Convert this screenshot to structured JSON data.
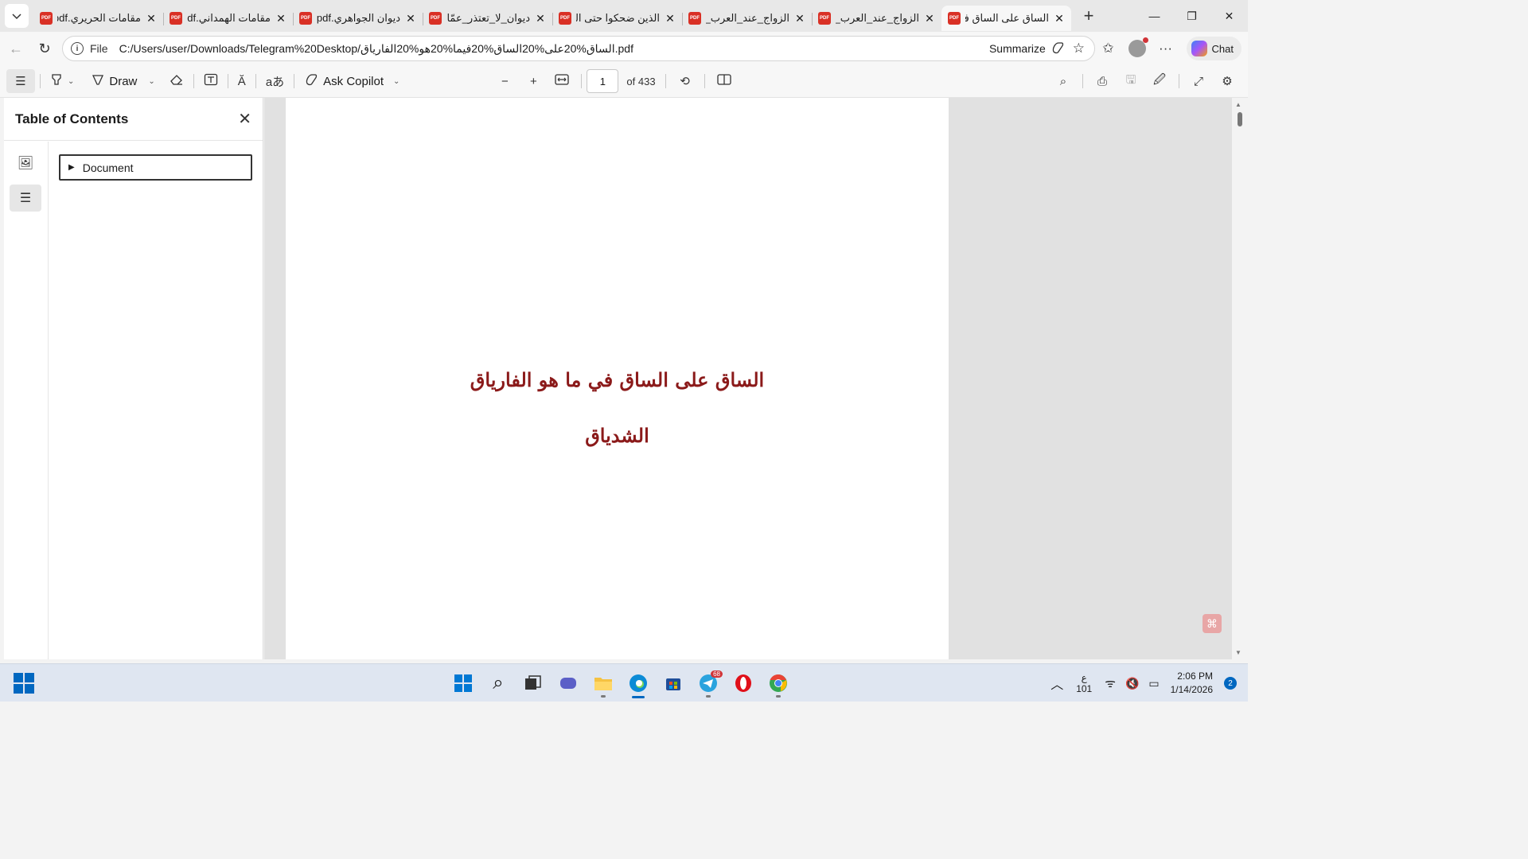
{
  "tabs": [
    {
      "title": "مقامات الحريري.pdf",
      "active": false
    },
    {
      "title": "مقامات الهمداني.pdf",
      "active": false
    },
    {
      "title": "ديوان الجواهري.pdf",
      "active": false
    },
    {
      "title": "ديوان_لا_تعتذر_عمّا فـ",
      "active": false
    },
    {
      "title": "الذين ضحكوا حتى الـ",
      "active": false
    },
    {
      "title": "الزواج_عند_العرب_في",
      "active": false
    },
    {
      "title": "الزواج_عند_العرب_في",
      "active": false
    },
    {
      "title": "الساق على الساق في",
      "active": true
    }
  ],
  "tab_icon_label": "PDF",
  "address": {
    "file_label": "File",
    "url": "C:/Users/user/Downloads/Telegram%20Desktop/الساق%20على%20الساق%20فيما%20هو%20الفارياق.pdf",
    "summarize_label": "Summarize",
    "chat_label": "Chat"
  },
  "pdf_toolbar": {
    "draw_label": "Draw",
    "ask_copilot_label": "Ask Copilot",
    "page_number": "1",
    "page_count_label": "of 433",
    "read_aloud_glyph": "Ă",
    "translate_glyph": "aあ"
  },
  "toc": {
    "title": "Table of Contents",
    "node_label": "Document"
  },
  "document": {
    "title_line1": "الساق على الساق في ما هو الفارياق",
    "title_line2": "الشدياق",
    "adobe_glyph": "⌘"
  },
  "taskbar": {
    "telegram_badge": "68",
    "ime_top": "ع",
    "ime_bottom": "101",
    "time": "2:06 PM",
    "date": "1/14/2026",
    "notification_count": "2"
  },
  "colors": {
    "pdf_title_color": "#8b1a1a",
    "accent": "#0067c0",
    "pdf_badge": "#d93025"
  }
}
